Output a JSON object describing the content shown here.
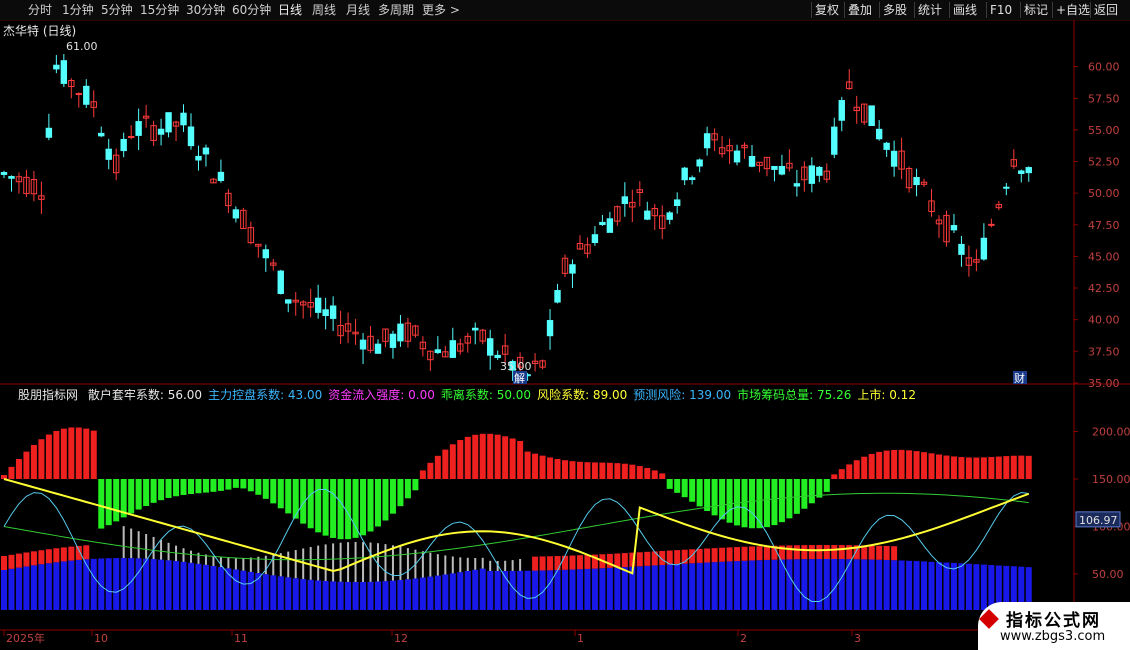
{
  "toolbar": {
    "periods": [
      "分时",
      "1分钟",
      "5分钟",
      "15分钟",
      "30分钟",
      "60分钟",
      "日线",
      "周线",
      "月线",
      "多周期",
      "更多 >"
    ],
    "active_period": "日线",
    "right_buttons": [
      "复权",
      "叠加",
      "多股",
      "统计",
      "画线",
      "F10",
      "标记",
      "+自选",
      "返回"
    ]
  },
  "stock": {
    "title": "杰华特 (日线)"
  },
  "price_axis": {
    "ticks": [
      "60.00",
      "57.50",
      "55.00",
      "52.50",
      "50.00",
      "47.50",
      "45.00",
      "42.50",
      "40.00",
      "37.50",
      "35.00"
    ]
  },
  "annotations": {
    "high": "61.00",
    "low": "35.00",
    "badge_jie": "解",
    "badge_cai": "财"
  },
  "indicator": {
    "name": "股朋指标网",
    "items": [
      {
        "label": "散户套牢系数: 56.00",
        "color": "#e8e8e8"
      },
      {
        "label": "主力控盘系数: 43.00",
        "color": "#3ab6ff"
      },
      {
        "label": "资金流入强度: 0.00",
        "color": "#ff3cff"
      },
      {
        "label": "乖离系数: 50.00",
        "color": "#33ff33"
      },
      {
        "label": "风险系数: 89.00",
        "color": "#ffff33"
      },
      {
        "label": "预测风险: 139.00",
        "color": "#3ab6ff"
      },
      {
        "label": "市场筹码总量: 75.26",
        "color": "#33ff33"
      },
      {
        "label": "上市: 0.12",
        "color": "#ffff33"
      }
    ]
  },
  "ind_axis": {
    "ticks": [
      "200.00",
      "150.00",
      "100.00",
      "50.00"
    ],
    "current": "106.97"
  },
  "time_axis": {
    "labels": [
      "2025年",
      "10",
      "11",
      "12",
      "1",
      "2",
      "3"
    ]
  },
  "logo": {
    "line1": "指标公式网",
    "line2": "www.zbgs3.com"
  },
  "colors": {
    "up": "#ff3b3b",
    "down": "#54ffff",
    "axis": "#8b0000"
  }
}
